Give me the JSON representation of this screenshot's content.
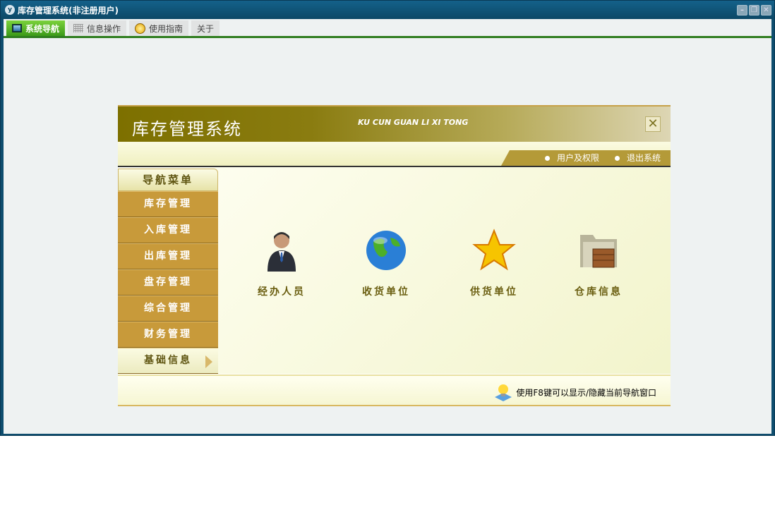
{
  "window": {
    "title": "库存管理系统(非注册用户)",
    "buttons": [
      "minimize",
      "restore",
      "close"
    ]
  },
  "tabs": [
    {
      "label": "系统导航",
      "icon": "monitor-icon",
      "active": true
    },
    {
      "label": "信息操作",
      "icon": "grid-icon"
    },
    {
      "label": "使用指南",
      "icon": "help-icon"
    },
    {
      "label": "关于"
    }
  ],
  "panel": {
    "title": "库存管理系统",
    "subtitle": "KU CUN GUAN LI XI TONG",
    "links": [
      "用户及权限",
      "退出系统"
    ]
  },
  "nav": {
    "header": "导航菜单",
    "items": [
      "库存管理",
      "入库管理",
      "出库管理",
      "盘存管理",
      "综合管理",
      "财务管理",
      "基础信息"
    ],
    "selected": "基础信息"
  },
  "tiles": [
    {
      "label": "经办人员",
      "icon": "person-icon"
    },
    {
      "label": "收货单位",
      "icon": "globe-icon"
    },
    {
      "label": "供货单位",
      "icon": "star-icon"
    },
    {
      "label": "仓库信息",
      "icon": "warehouse-folder-icon"
    }
  ],
  "footer": {
    "tip": "使用F8键可以显示/隐藏当前导航窗口"
  }
}
